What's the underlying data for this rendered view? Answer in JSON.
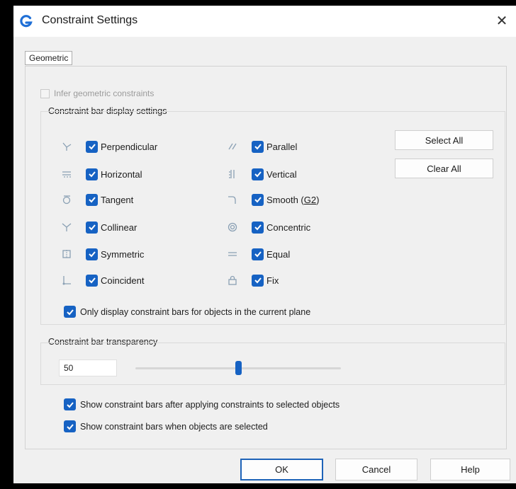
{
  "window": {
    "title": "Constraint Settings",
    "close_symbol": "✕"
  },
  "tabs": [
    {
      "label": "Geometric",
      "selected": true
    }
  ],
  "infer": {
    "label": "Infer geometric constraints",
    "checked": false,
    "enabled": false
  },
  "display_settings": {
    "group_label": "Constraint bar display settings",
    "left_column": [
      {
        "label": "Perpendicular",
        "icon": "perpendicular-icon",
        "checked": true
      },
      {
        "label": "Horizontal",
        "icon": "horizontal-icon",
        "checked": true
      },
      {
        "label": "Tangent",
        "icon": "tangent-icon",
        "checked": true
      },
      {
        "label": "Collinear",
        "icon": "collinear-icon",
        "checked": true
      },
      {
        "label": "Symmetric",
        "icon": "symmetric-icon",
        "checked": true
      },
      {
        "label": "Coincident",
        "icon": "coincident-icon",
        "checked": true
      }
    ],
    "right_column": [
      {
        "label": "Parallel",
        "icon": "parallel-icon",
        "checked": true
      },
      {
        "label": "Vertical",
        "icon": "vertical-icon",
        "checked": true
      },
      {
        "label_prefix": "Smooth (",
        "label_underlined": "G2",
        "label_suffix": ")",
        "icon": "smooth-icon",
        "checked": true
      },
      {
        "label": "Concentric",
        "icon": "concentric-icon",
        "checked": true
      },
      {
        "label": "Equal",
        "icon": "equal-icon",
        "checked": true
      },
      {
        "label": "Fix",
        "icon": "fix-icon",
        "checked": true
      }
    ],
    "select_all_label": "Select All",
    "clear_all_label": "Clear All",
    "current_plane": {
      "label": "Only display constraint bars for objects in the current plane",
      "checked": true
    }
  },
  "transparency": {
    "group_label": "Constraint bar transparency",
    "value": "50",
    "slider_fraction": 0.5
  },
  "options": [
    {
      "label": "Show constraint bars after applying constraints to selected objects",
      "checked": true
    },
    {
      "label": "Show constraint bars when objects are selected",
      "checked": true
    }
  ],
  "footer": {
    "ok_label": "OK",
    "cancel_label": "Cancel",
    "help_label": "Help"
  },
  "colors": {
    "accent": "#1662c3",
    "dialog_bg": "#f0f0f0",
    "backdrop": "#000000"
  }
}
